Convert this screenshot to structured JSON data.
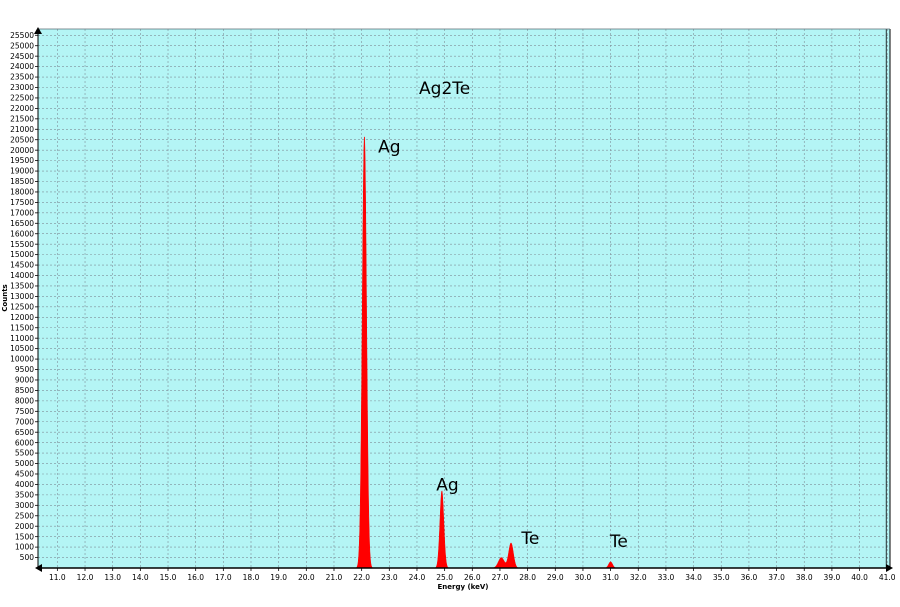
{
  "chart_data": {
    "type": "area",
    "title": "",
    "xlabel": "Energy (keV)",
    "ylabel": "Counts",
    "xlim": [
      10.3,
      41.1
    ],
    "ylim": [
      0,
      25800
    ],
    "x_ticks": [
      11,
      12,
      13,
      14,
      15,
      16,
      17,
      18,
      19,
      20,
      21,
      22,
      23,
      24,
      25,
      26,
      27,
      28,
      29,
      30,
      31,
      32,
      33,
      34,
      35,
      36,
      37,
      38,
      39,
      40,
      41
    ],
    "x_tick_labels": [
      "11.0",
      "12.0",
      "13.0",
      "14.0",
      "15.0",
      "16.0",
      "17.0",
      "18.0",
      "19.0",
      "20.0",
      "21.0",
      "22.0",
      "23.0",
      "24.0",
      "25.0",
      "26.0",
      "27.0",
      "28.0",
      "29.0",
      "30.0",
      "31.0",
      "32.0",
      "33.0",
      "34.0",
      "35.0",
      "36.0",
      "37.0",
      "38.0",
      "39.0",
      "40.0",
      "41.0"
    ],
    "y_ticks": [
      500,
      1000,
      1500,
      2000,
      2500,
      3000,
      3500,
      4000,
      4500,
      5000,
      5500,
      6000,
      6500,
      7000,
      7500,
      8000,
      8500,
      9000,
      9500,
      10000,
      10500,
      11000,
      11500,
      12000,
      12500,
      13000,
      13500,
      14000,
      14500,
      15000,
      15500,
      16000,
      16500,
      17000,
      17500,
      18000,
      18500,
      19000,
      19500,
      20000,
      20500,
      21000,
      21500,
      22000,
      22500,
      23000,
      23500,
      24000,
      24500,
      25000,
      25500
    ],
    "grid": true,
    "background_color": "#b4f5f5",
    "series_color": "#ff0000",
    "series": [
      {
        "peaks": [
          {
            "center": 22.1,
            "height": 20700,
            "width": 0.11
          },
          {
            "center": 24.9,
            "height": 3700,
            "width": 0.1
          },
          {
            "center": 27.4,
            "height": 1200,
            "width": 0.12
          },
          {
            "center": 27.05,
            "height": 500,
            "width": 0.15
          },
          {
            "center": 31.0,
            "height": 300,
            "width": 0.1
          }
        ]
      }
    ],
    "annotations": [
      {
        "text": "Ag2Te",
        "x": 25.0,
        "y": 22700
      },
      {
        "text": "Ag",
        "x": 23.0,
        "y": 19900
      },
      {
        "text": "Ag",
        "x": 25.1,
        "y": 3700
      },
      {
        "text": "Te",
        "x": 28.1,
        "y": 1150
      },
      {
        "text": "Te",
        "x": 31.3,
        "y": 1000
      }
    ]
  }
}
